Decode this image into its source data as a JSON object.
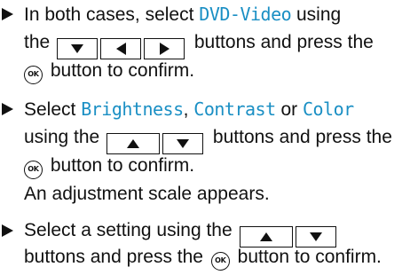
{
  "steps": [
    {
      "line1": {
        "a": "In both cases, select ",
        "menu": "DVD-Video",
        "b": " using"
      },
      "line2": {
        "a": "the ",
        "b": " buttons and press the"
      },
      "line3": {
        "ok": "OK",
        "a": " button to confirm."
      }
    },
    {
      "line1": {
        "a": "Select ",
        "menu1": "Brightness",
        "sep1": ", ",
        "menu2": "Contrast",
        "sep2": " or ",
        "menu3": "Color"
      },
      "line2": {
        "a": "using the ",
        "b": " buttons and press the"
      },
      "line3": {
        "ok": "OK",
        "a": " button to confirm."
      },
      "line4": "An adjustment scale appears."
    },
    {
      "line1": {
        "a": "Select a setting using the "
      },
      "line2": {
        "a": "buttons and press the ",
        "ok": "OK",
        "b": " button to confirm."
      }
    }
  ],
  "icons": [
    "bullet-arrow-icon",
    "down-arrow-icon",
    "left-arrow-icon",
    "right-arrow-icon",
    "up-arrow-icon",
    "ok-button-icon"
  ],
  "colors": {
    "menu_text": "#1a8fc4",
    "body_text": "#111111"
  }
}
